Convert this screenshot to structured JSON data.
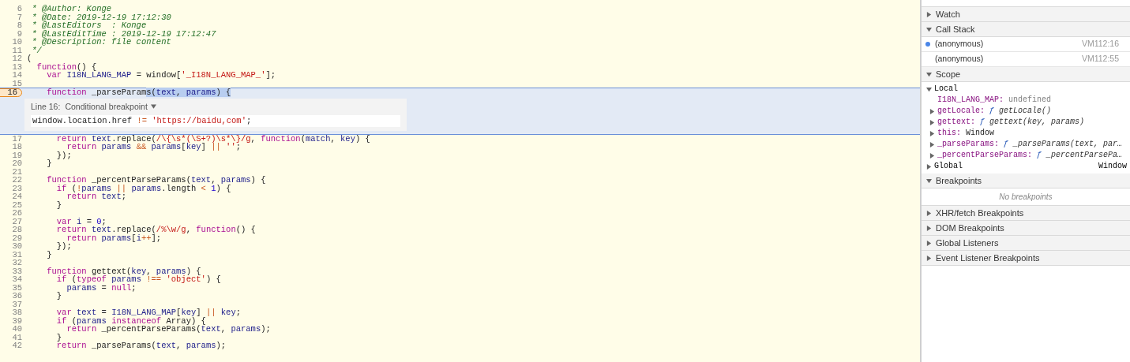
{
  "editor": {
    "lines": [
      {
        "number": "6",
        "breakpoint": false,
        "tokens": [
          {
            "kind": "comment",
            "text": " * @Author: Konge"
          }
        ]
      },
      {
        "number": "7",
        "breakpoint": false,
        "tokens": [
          {
            "kind": "comment",
            "text": " * @Date: 2019-12-19 17:12:30"
          }
        ]
      },
      {
        "number": "8",
        "breakpoint": false,
        "tokens": [
          {
            "kind": "comment",
            "text": " * @LastEditors  : Konge"
          }
        ]
      },
      {
        "number": "9",
        "breakpoint": false,
        "tokens": [
          {
            "kind": "comment",
            "text": " * @LastEditTime : 2019-12-19 17:12:47"
          }
        ]
      },
      {
        "number": "10",
        "breakpoint": false,
        "tokens": [
          {
            "kind": "comment",
            "text": " * @Description: file content"
          }
        ]
      },
      {
        "number": "11",
        "breakpoint": false,
        "tokens": [
          {
            "kind": "comment",
            "text": " */"
          }
        ]
      },
      {
        "number": "12",
        "breakpoint": false,
        "tokens": [
          {
            "kind": "plain",
            "text": "("
          }
        ]
      },
      {
        "number": "13",
        "breakpoint": false,
        "tokens": [
          {
            "kind": "keyword",
            "text": "  function"
          },
          {
            "kind": "plain",
            "text": "() {"
          }
        ]
      },
      {
        "number": "14",
        "breakpoint": false,
        "tokens": [
          {
            "kind": "keyword",
            "text": "    var"
          },
          {
            "kind": "name",
            "text": " I18N_LANG_MAP"
          },
          {
            "kind": "plain",
            "text": " = window["
          },
          {
            "kind": "string",
            "text": "'_I18N_LANG_MAP_'"
          },
          {
            "kind": "plain",
            "text": "];"
          }
        ]
      },
      {
        "number": "15",
        "breakpoint": false
      },
      {
        "number": "16",
        "breakpoint": true,
        "tokens": [
          {
            "kind": "keyword",
            "text": "    function"
          },
          {
            "kind": "plain",
            "text": " _parseParam"
          }
        ],
        "selected_tokens": [
          {
            "kind": "plain",
            "text": "s("
          },
          {
            "kind": "name",
            "text": "text"
          },
          {
            "kind": "plain",
            "text": ", "
          },
          {
            "kind": "name",
            "text": "params"
          },
          {
            "kind": "plain",
            "text": ") {"
          }
        ],
        "conditional_breakpoint": {
          "line_label": "Line 16:",
          "type_label": "Conditional breakpoint",
          "condition": [
            {
              "kind": "plain",
              "text": "window.location.href "
            },
            {
              "kind": "operator",
              "text": "!="
            },
            {
              "kind": "string",
              "text": " 'https://baidu,com'"
            },
            {
              "kind": "plain",
              "text": ";"
            }
          ]
        }
      },
      {
        "number": "17",
        "breakpoint": false,
        "tokens": [
          {
            "kind": "keyword",
            "text": "      return"
          },
          {
            "kind": "name",
            "text": " text"
          },
          {
            "kind": "plain",
            "text": ".replace("
          },
          {
            "kind": "string",
            "text": "/\\{\\s*(\\S+?)\\s*\\}/g"
          },
          {
            "kind": "plain",
            "text": ", "
          },
          {
            "kind": "keyword",
            "text": "function"
          },
          {
            "kind": "plain",
            "text": "("
          },
          {
            "kind": "name",
            "text": "match"
          },
          {
            "kind": "plain",
            "text": ", "
          },
          {
            "kind": "name",
            "text": "key"
          },
          {
            "kind": "plain",
            "text": ") {"
          }
        ]
      },
      {
        "number": "18",
        "breakpoint": false,
        "tokens": [
          {
            "kind": "keyword",
            "text": "        return"
          },
          {
            "kind": "name",
            "text": " params"
          },
          {
            "kind": "operator",
            "text": " && "
          },
          {
            "kind": "name",
            "text": "params"
          },
          {
            "kind": "plain",
            "text": "["
          },
          {
            "kind": "name",
            "text": "key"
          },
          {
            "kind": "plain",
            "text": "] "
          },
          {
            "kind": "operator",
            "text": "||"
          },
          {
            "kind": "string",
            "text": " ''"
          },
          {
            "kind": "plain",
            "text": ";"
          }
        ]
      },
      {
        "number": "19",
        "breakpoint": false,
        "tokens": [
          {
            "kind": "plain",
            "text": "      });"
          }
        ]
      },
      {
        "number": "20",
        "breakpoint": false,
        "tokens": [
          {
            "kind": "plain",
            "text": "    }"
          }
        ]
      },
      {
        "number": "21",
        "breakpoint": false
      },
      {
        "number": "22",
        "breakpoint": false,
        "tokens": [
          {
            "kind": "keyword",
            "text": "    function"
          },
          {
            "kind": "plain",
            "text": " _percentParseParams("
          },
          {
            "kind": "name",
            "text": "text"
          },
          {
            "kind": "plain",
            "text": ", "
          },
          {
            "kind": "name",
            "text": "params"
          },
          {
            "kind": "plain",
            "text": ") {"
          }
        ]
      },
      {
        "number": "23",
        "breakpoint": false,
        "tokens": [
          {
            "kind": "keyword",
            "text": "      if"
          },
          {
            "kind": "plain",
            "text": " ("
          },
          {
            "kind": "operator",
            "text": "!"
          },
          {
            "kind": "name",
            "text": "params"
          },
          {
            "kind": "operator",
            "text": " || "
          },
          {
            "kind": "name",
            "text": "params"
          },
          {
            "kind": "plain",
            "text": ".length "
          },
          {
            "kind": "operator",
            "text": "<"
          },
          {
            "kind": "number",
            "text": " 1"
          },
          {
            "kind": "plain",
            "text": ") {"
          }
        ]
      },
      {
        "number": "24",
        "breakpoint": false,
        "tokens": [
          {
            "kind": "keyword",
            "text": "        return"
          },
          {
            "kind": "name",
            "text": " text"
          },
          {
            "kind": "plain",
            "text": ";"
          }
        ]
      },
      {
        "number": "25",
        "breakpoint": false,
        "tokens": [
          {
            "kind": "plain",
            "text": "      }"
          }
        ]
      },
      {
        "number": "26",
        "breakpoint": false
      },
      {
        "number": "27",
        "breakpoint": false,
        "tokens": [
          {
            "kind": "keyword",
            "text": "      var"
          },
          {
            "kind": "name",
            "text": " i"
          },
          {
            "kind": "plain",
            "text": " = "
          },
          {
            "kind": "number",
            "text": "0"
          },
          {
            "kind": "plain",
            "text": ";"
          }
        ]
      },
      {
        "number": "28",
        "breakpoint": false,
        "tokens": [
          {
            "kind": "keyword",
            "text": "      return"
          },
          {
            "kind": "name",
            "text": " text"
          },
          {
            "kind": "plain",
            "text": ".replace("
          },
          {
            "kind": "string",
            "text": "/%\\w/g"
          },
          {
            "kind": "plain",
            "text": ", "
          },
          {
            "kind": "keyword",
            "text": "function"
          },
          {
            "kind": "plain",
            "text": "() {"
          }
        ]
      },
      {
        "number": "29",
        "breakpoint": false,
        "tokens": [
          {
            "kind": "keyword",
            "text": "        return"
          },
          {
            "kind": "name",
            "text": " params"
          },
          {
            "kind": "plain",
            "text": "["
          },
          {
            "kind": "name",
            "text": "i"
          },
          {
            "kind": "operator",
            "text": "++"
          },
          {
            "kind": "plain",
            "text": "];"
          }
        ]
      },
      {
        "number": "30",
        "breakpoint": false,
        "tokens": [
          {
            "kind": "plain",
            "text": "      });"
          }
        ]
      },
      {
        "number": "31",
        "breakpoint": false,
        "tokens": [
          {
            "kind": "plain",
            "text": "    }"
          }
        ]
      },
      {
        "number": "32",
        "breakpoint": false
      },
      {
        "number": "33",
        "breakpoint": false,
        "tokens": [
          {
            "kind": "keyword",
            "text": "    function"
          },
          {
            "kind": "plain",
            "text": " gettext("
          },
          {
            "kind": "name",
            "text": "key"
          },
          {
            "kind": "plain",
            "text": ", "
          },
          {
            "kind": "name",
            "text": "params"
          },
          {
            "kind": "plain",
            "text": ") {"
          }
        ]
      },
      {
        "number": "34",
        "breakpoint": false,
        "tokens": [
          {
            "kind": "keyword",
            "text": "      if"
          },
          {
            "kind": "plain",
            "text": " ("
          },
          {
            "kind": "keyword",
            "text": "typeof"
          },
          {
            "kind": "name",
            "text": " params"
          },
          {
            "kind": "operator",
            "text": " !== "
          },
          {
            "kind": "string",
            "text": "'object'"
          },
          {
            "kind": "plain",
            "text": ") {"
          }
        ]
      },
      {
        "number": "35",
        "breakpoint": false,
        "tokens": [
          {
            "kind": "name",
            "text": "        params"
          },
          {
            "kind": "plain",
            "text": " = "
          },
          {
            "kind": "keyword",
            "text": "null"
          },
          {
            "kind": "plain",
            "text": ";"
          }
        ]
      },
      {
        "number": "36",
        "breakpoint": false,
        "tokens": [
          {
            "kind": "plain",
            "text": "      }"
          }
        ]
      },
      {
        "number": "37",
        "breakpoint": false
      },
      {
        "number": "38",
        "breakpoint": false,
        "tokens": [
          {
            "kind": "keyword",
            "text": "      var"
          },
          {
            "kind": "name",
            "text": " text"
          },
          {
            "kind": "plain",
            "text": " = "
          },
          {
            "kind": "name",
            "text": "I18N_LANG_MAP"
          },
          {
            "kind": "plain",
            "text": "["
          },
          {
            "kind": "name",
            "text": "key"
          },
          {
            "kind": "plain",
            "text": "] "
          },
          {
            "kind": "operator",
            "text": "||"
          },
          {
            "kind": "name",
            "text": " key"
          },
          {
            "kind": "plain",
            "text": ";"
          }
        ]
      },
      {
        "number": "39",
        "breakpoint": false,
        "tokens": [
          {
            "kind": "keyword",
            "text": "      if"
          },
          {
            "kind": "plain",
            "text": " ("
          },
          {
            "kind": "name",
            "text": "params"
          },
          {
            "kind": "keyword",
            "text": " instanceof"
          },
          {
            "kind": "plain",
            "text": " Array) {"
          }
        ]
      },
      {
        "number": "40",
        "breakpoint": false,
        "tokens": [
          {
            "kind": "keyword",
            "text": "        return"
          },
          {
            "kind": "plain",
            "text": " _percentParseParams("
          },
          {
            "kind": "name",
            "text": "text"
          },
          {
            "kind": "plain",
            "text": ", "
          },
          {
            "kind": "name",
            "text": "params"
          },
          {
            "kind": "plain",
            "text": ");"
          }
        ]
      },
      {
        "number": "41",
        "breakpoint": false,
        "tokens": [
          {
            "kind": "plain",
            "text": "      }"
          }
        ]
      },
      {
        "number": "42",
        "breakpoint": false,
        "tokens": [
          {
            "kind": "keyword",
            "text": "      return"
          },
          {
            "kind": "plain",
            "text": " _parseParams("
          },
          {
            "kind": "name",
            "text": "text"
          },
          {
            "kind": "plain",
            "text": ", "
          },
          {
            "kind": "name",
            "text": "params"
          },
          {
            "kind": "plain",
            "text": ");"
          }
        ]
      }
    ]
  },
  "sidebar": {
    "sections": [
      {
        "kind": "plain",
        "title": "Watch",
        "expanded": false
      },
      {
        "kind": "call_stack",
        "title": "Call Stack",
        "expanded": true,
        "frames": [
          {
            "name": "(anonymous)",
            "location": "VM112:16",
            "selected": true
          },
          {
            "name": "(anonymous)",
            "location": "VM112:55",
            "selected": false
          }
        ]
      },
      {
        "kind": "scope",
        "title": "Scope",
        "expanded": true,
        "scopes": [
          {
            "name": "Local",
            "expanded": true,
            "children": [
              {
                "name": "I18N_LANG_MAP:",
                "kind": "undefined",
                "value": "undefined",
                "expandable": false
              },
              {
                "name": "getLocale:",
                "kind": "function",
                "prefix": "ƒ",
                "value": "getLocale()",
                "expandable": true
              },
              {
                "name": "gettext:",
                "kind": "function",
                "prefix": "ƒ",
                "value": "gettext(key, params)",
                "expandable": true
              },
              {
                "name": "this:",
                "kind": "object",
                "value": "Window",
                "expandable": true
              },
              {
                "name": "_parseParams:",
                "kind": "function",
                "prefix": "ƒ",
                "value": "_parseParams(text, par…",
                "expandable": true
              },
              {
                "name": "_percentParseParams:",
                "kind": "function",
                "prefix": "ƒ",
                "value": "_percentParsePa…",
                "expandable": true
              }
            ]
          },
          {
            "name": "Global",
            "expanded": false,
            "value": "Window"
          }
        ]
      },
      {
        "kind": "breakpoints",
        "title": "Breakpoints",
        "expanded": true,
        "empty_message": "No breakpoints"
      },
      {
        "kind": "plain",
        "title": "XHR/fetch Breakpoints",
        "expanded": false
      },
      {
        "kind": "plain",
        "title": "DOM Breakpoints",
        "expanded": false
      },
      {
        "kind": "plain",
        "title": "Global Listeners",
        "expanded": false
      },
      {
        "kind": "plain",
        "title": "Event Listener Breakpoints",
        "expanded": false
      }
    ]
  }
}
